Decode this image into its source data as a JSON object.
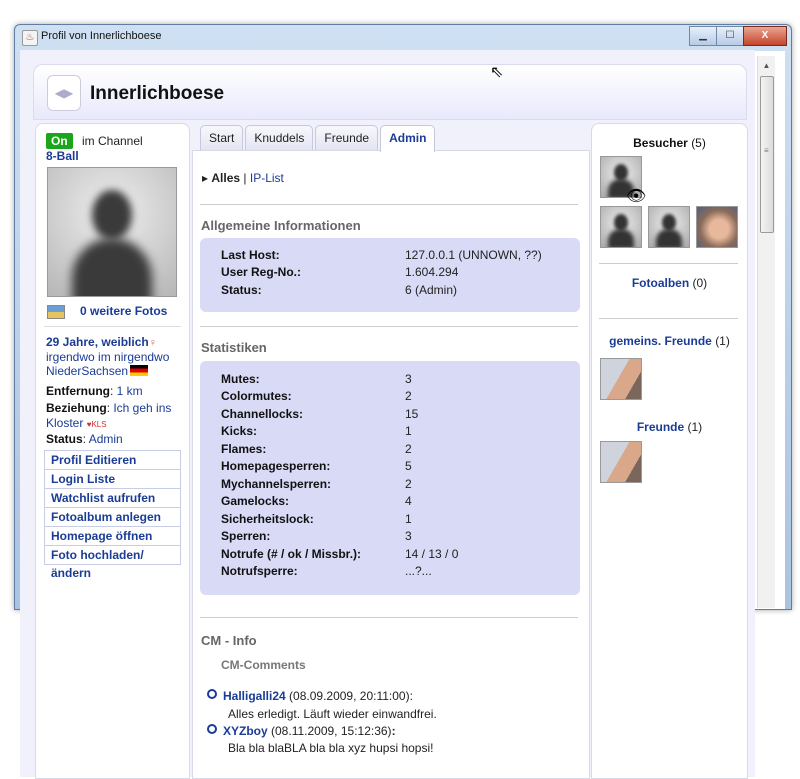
{
  "window": {
    "title": "Profil von Innerlichboese",
    "buttons": {
      "minimize": "▁",
      "maximize": "☐",
      "close": "X"
    }
  },
  "profile": {
    "name": "Innerlichboese"
  },
  "left": {
    "online_badge": "On",
    "in_channel_label": "im Channel",
    "channel": "8-Ball",
    "more_photos": "0 weitere Fotos",
    "age_gender": "29 Jahre, weiblich",
    "location_line1": "irgendwo im nirgendwo",
    "location_line2": "NiederSachsen",
    "distance_label": "Entfernung",
    "distance_value": "1 km",
    "relationship_label": "Beziehung",
    "relationship_value": "Ich geh ins Kloster",
    "relationship_badge": "KLS",
    "status_label": "Status",
    "status_value": "Admin",
    "menu": [
      "Profil Editieren",
      "Login Liste",
      "Watchlist aufrufen",
      "Fotoalbum anlegen",
      "Homepage öffnen",
      "Foto hochladen/ändern"
    ]
  },
  "tabs": [
    "Start",
    "Knuddels",
    "Freunde",
    "Admin"
  ],
  "active_tab": "Admin",
  "subnav": {
    "current": "Alles",
    "separator": "|",
    "link": "IP-List"
  },
  "general": {
    "title": "Allgemeine Informationen",
    "rows": [
      {
        "k": "Last Host:",
        "v": "127.0.0.1 (UNNOWN, ??)"
      },
      {
        "k": "User Reg-No.:",
        "v": "1.604.294"
      },
      {
        "k": "Status:",
        "v": "6 (Admin)"
      }
    ]
  },
  "stats": {
    "title": "Statistiken",
    "rows": [
      {
        "k": "Mutes:",
        "v": "3"
      },
      {
        "k": "Colormutes:",
        "v": "2"
      },
      {
        "k": "Channellocks:",
        "v": "15"
      },
      {
        "k": "Kicks:",
        "v": "1"
      },
      {
        "k": "Flames:",
        "v": "2"
      },
      {
        "k": "Homepagesperren:",
        "v": "5"
      },
      {
        "k": "Mychannelsperren:",
        "v": "2"
      },
      {
        "k": "Gamelocks:",
        "v": "4"
      },
      {
        "k": "Sicherheitslock:",
        "v": "1"
      },
      {
        "k": "Sperren:",
        "v": "3"
      },
      {
        "k": "Notrufe (# / ok / Missbr.):",
        "v": "14 / 13 / 0"
      },
      {
        "k": "Notrufsperre:",
        "v": "...?..."
      }
    ]
  },
  "cm": {
    "title": "CM - Info",
    "subtitle": "CM-Comments",
    "comments": [
      {
        "name": "Halligalli24",
        "date": "(08.09.2009, 20:11:00):",
        "text": "Alles erledigt. Läuft wieder einwandfrei."
      },
      {
        "name": "XYZboy",
        "date": "(08.11.2009, 15:12:36)",
        "colon": ":",
        "text": "Bla bla blaBLA bla bla xyz hupsi hopsi!"
      }
    ]
  },
  "right": {
    "visitors_label": "Besucher",
    "visitors_count": "(5)",
    "albums_label": "Fotoalben",
    "albums_count": "(0)",
    "mutual_label": "gemeins. Freunde",
    "mutual_count": "(1)",
    "friends_label": "Freunde",
    "friends_count": "(1)"
  },
  "icons": [
    "java-icon",
    "eye-icon",
    "female-icon",
    "germany-flag-icon",
    "photos-icon",
    "cursor-icon"
  ]
}
